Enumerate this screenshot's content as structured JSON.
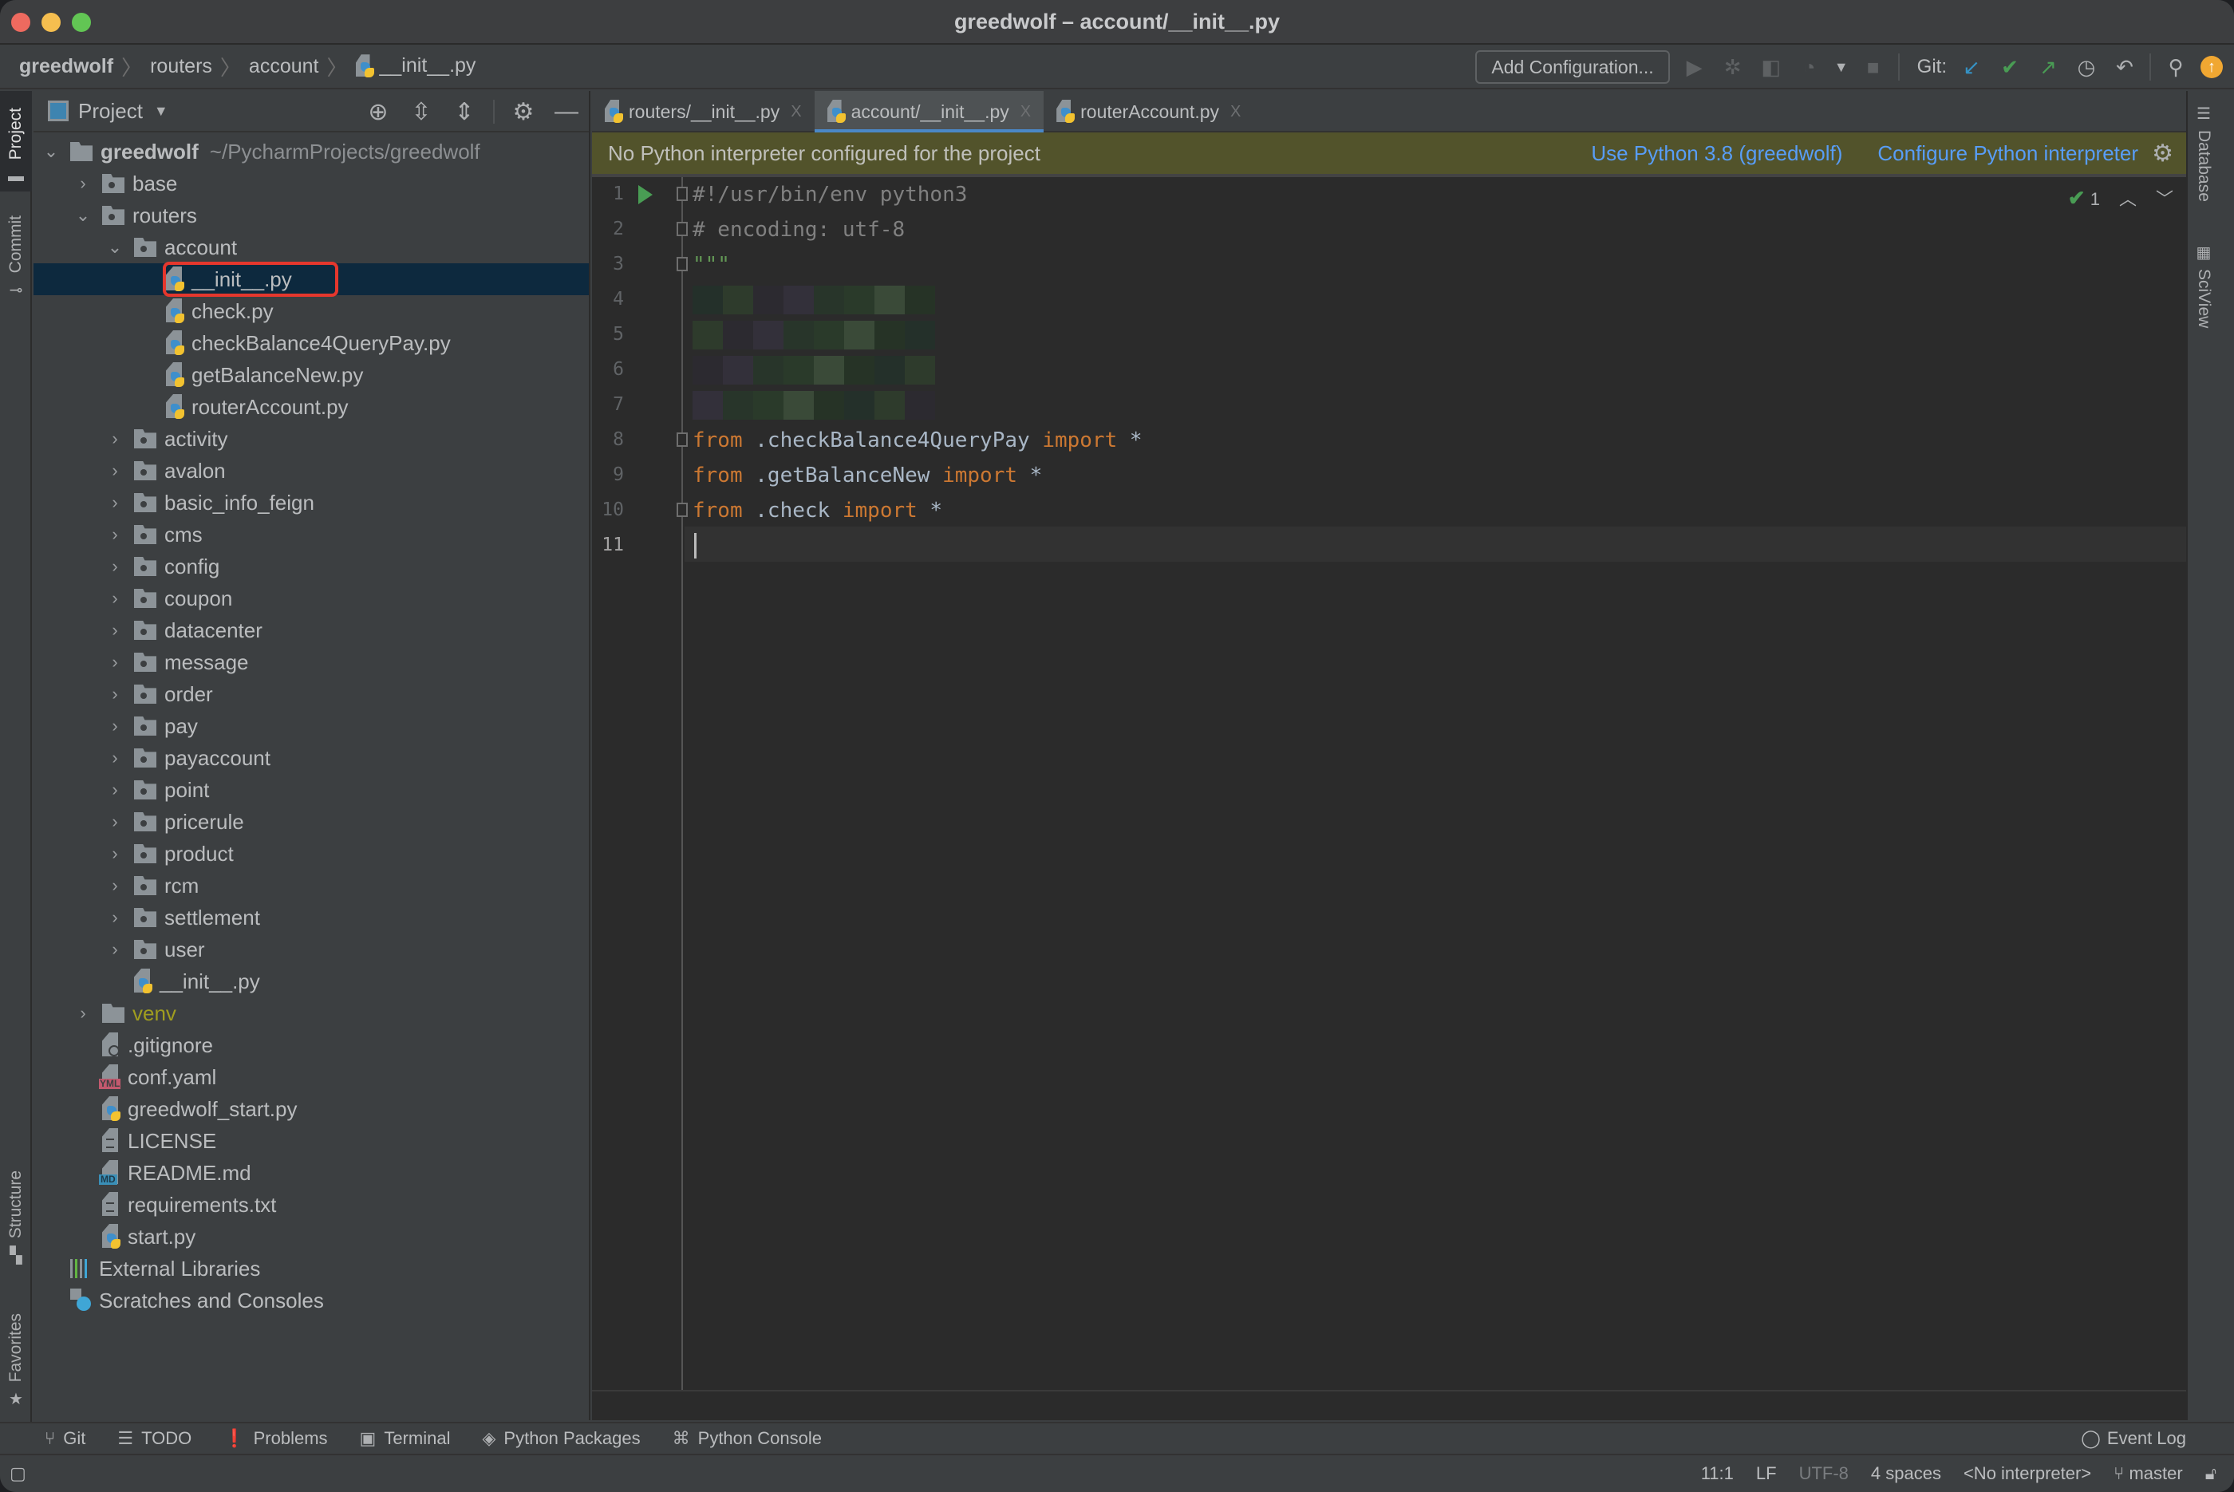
{
  "window": {
    "title": "greedwolf – account/__init__.py"
  },
  "navbar": {
    "breadcrumbs": [
      "greedwolf",
      "routers",
      "account",
      "__init__.py"
    ],
    "add_configuration_label": "Add Configuration...",
    "git_label": "Git:",
    "toolbar_icons": [
      "run-icon",
      "debug-icon",
      "coverage-icon",
      "profile-icon",
      "dropdown-arrow-icon",
      "stop-icon",
      "git-update-icon",
      "git-commit-icon",
      "git-push-icon",
      "history-icon",
      "rollback-icon",
      "search-icon",
      "update-available-icon"
    ]
  },
  "left_strip": {
    "tabs": [
      "Project",
      "Commit",
      "Structure",
      "Favorites"
    ]
  },
  "right_strip": {
    "tabs": [
      "Database",
      "SciView"
    ]
  },
  "project_panel": {
    "title": "Project",
    "header_icons": [
      "locate-icon",
      "expand-all-icon",
      "collapse-all-icon",
      "gear-icon",
      "hide-icon"
    ],
    "root": {
      "name": "greedwolf",
      "path": "~/PycharmProjects/greedwolf"
    },
    "tree": [
      {
        "label": "base",
        "type": "package",
        "depth": 1,
        "expanded": false
      },
      {
        "label": "routers",
        "type": "package",
        "depth": 1,
        "expanded": true
      },
      {
        "label": "account",
        "type": "package",
        "depth": 2,
        "expanded": true
      },
      {
        "label": "__init__.py",
        "type": "python",
        "depth": 3,
        "selected": true,
        "highlighted": true
      },
      {
        "label": "check.py",
        "type": "python",
        "depth": 3
      },
      {
        "label": "checkBalance4QueryPay.py",
        "type": "python",
        "depth": 3
      },
      {
        "label": "getBalanceNew.py",
        "type": "python",
        "depth": 3
      },
      {
        "label": "routerAccount.py",
        "type": "python",
        "depth": 3
      },
      {
        "label": "activity",
        "type": "package",
        "depth": 2,
        "expanded": false
      },
      {
        "label": "avalon",
        "type": "package",
        "depth": 2,
        "expanded": false
      },
      {
        "label": "basic_info_feign",
        "type": "package",
        "depth": 2,
        "expanded": false
      },
      {
        "label": "cms",
        "type": "package",
        "depth": 2,
        "expanded": false
      },
      {
        "label": "config",
        "type": "package",
        "depth": 2,
        "expanded": false
      },
      {
        "label": "coupon",
        "type": "package",
        "depth": 2,
        "expanded": false
      },
      {
        "label": "datacenter",
        "type": "package",
        "depth": 2,
        "expanded": false
      },
      {
        "label": "message",
        "type": "package",
        "depth": 2,
        "expanded": false
      },
      {
        "label": "order",
        "type": "package",
        "depth": 2,
        "expanded": false
      },
      {
        "label": "pay",
        "type": "package",
        "depth": 2,
        "expanded": false
      },
      {
        "label": "payaccount",
        "type": "package",
        "depth": 2,
        "expanded": false
      },
      {
        "label": "point",
        "type": "package",
        "depth": 2,
        "expanded": false
      },
      {
        "label": "pricerule",
        "type": "package",
        "depth": 2,
        "expanded": false
      },
      {
        "label": "product",
        "type": "package",
        "depth": 2,
        "expanded": false
      },
      {
        "label": "rcm",
        "type": "package",
        "depth": 2,
        "expanded": false
      },
      {
        "label": "settlement",
        "type": "package",
        "depth": 2,
        "expanded": false
      },
      {
        "label": "user",
        "type": "package",
        "depth": 2,
        "expanded": false
      },
      {
        "label": "__init__.py",
        "type": "python",
        "depth": 2
      },
      {
        "label": "venv",
        "type": "folder-excluded",
        "depth": 1,
        "expanded": false
      },
      {
        "label": ".gitignore",
        "type": "gitignore",
        "depth": 1
      },
      {
        "label": "conf.yaml",
        "type": "yaml",
        "depth": 1
      },
      {
        "label": "greedwolf_start.py",
        "type": "python",
        "depth": 1
      },
      {
        "label": "LICENSE",
        "type": "text",
        "depth": 1
      },
      {
        "label": "README.md",
        "type": "markdown",
        "depth": 1
      },
      {
        "label": "requirements.txt",
        "type": "text",
        "depth": 1
      },
      {
        "label": "start.py",
        "type": "python",
        "depth": 1
      }
    ],
    "extra": [
      {
        "label": "External Libraries",
        "type": "libraries"
      },
      {
        "label": "Scratches and Consoles",
        "type": "scratches"
      }
    ]
  },
  "editor": {
    "tabs": [
      {
        "label": "routers/__init__.py",
        "active": false
      },
      {
        "label": "account/__init__.py",
        "active": true
      },
      {
        "label": "routerAccount.py",
        "active": false
      }
    ],
    "banner": {
      "message": "No Python interpreter configured for the project",
      "link_use": "Use Python 3.8 (greedwolf)",
      "link_configure": "Configure Python interpreter"
    },
    "inspection": {
      "count": "1"
    },
    "lines": [
      {
        "n": "1",
        "tokens": [
          {
            "t": "#!/usr/bin/env python3",
            "c": "cm"
          }
        ]
      },
      {
        "n": "2",
        "tokens": [
          {
            "t": "# encoding: utf-8",
            "c": "cm"
          }
        ]
      },
      {
        "n": "3",
        "tokens": [
          {
            "t": "\"\"\"",
            "c": "str"
          }
        ]
      },
      {
        "n": "4",
        "tokens": [],
        "redacted": true
      },
      {
        "n": "5",
        "tokens": [],
        "redacted": true
      },
      {
        "n": "6",
        "tokens": [],
        "redacted": true
      },
      {
        "n": "7",
        "tokens": [],
        "redacted": true
      },
      {
        "n": "8",
        "tokens": [
          {
            "t": "from",
            "c": "kw"
          },
          {
            "t": " .checkBalance4QueryPay ",
            "c": "id"
          },
          {
            "t": "import",
            "c": "kw"
          },
          {
            "t": " *",
            "c": "id"
          }
        ]
      },
      {
        "n": "9",
        "tokens": [
          {
            "t": "from",
            "c": "kw"
          },
          {
            "t": " .getBalanceNew ",
            "c": "id"
          },
          {
            "t": "import",
            "c": "kw"
          },
          {
            "t": " *",
            "c": "id"
          }
        ]
      },
      {
        "n": "10",
        "tokens": [
          {
            "t": "from",
            "c": "kw"
          },
          {
            "t": " .check ",
            "c": "id"
          },
          {
            "t": "import",
            "c": "kw"
          },
          {
            "t": " *",
            "c": "id"
          }
        ]
      },
      {
        "n": "11",
        "tokens": [],
        "current": true
      }
    ]
  },
  "bottom_tools": [
    {
      "label": "Git",
      "icon": "git-icon"
    },
    {
      "label": "TODO",
      "icon": "todo-icon"
    },
    {
      "label": "Problems",
      "icon": "problems-icon"
    },
    {
      "label": "Terminal",
      "icon": "terminal-icon"
    },
    {
      "label": "Python Packages",
      "icon": "packages-icon"
    },
    {
      "label": "Python Console",
      "icon": "python-console-icon"
    }
  ],
  "event_log_label": "Event Log",
  "status_bar": {
    "position": "11:1",
    "line_separator": "LF",
    "encoding": "UTF-8",
    "indent": "4 spaces",
    "interpreter": "<No interpreter>",
    "branch": "master"
  }
}
